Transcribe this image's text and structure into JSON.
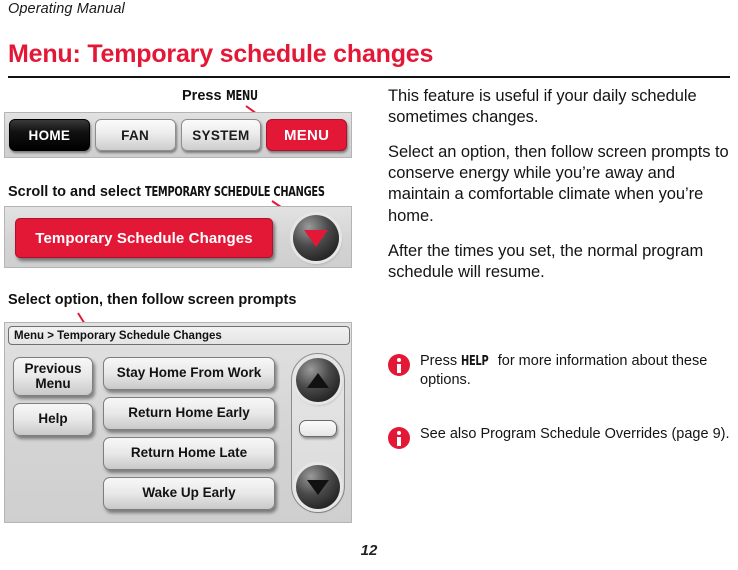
{
  "running_head": "Operating Manual",
  "page_title": "Menu: Temporary schedule changes",
  "folio": "12",
  "accent_color": "#E31837",
  "steps": [
    {
      "callout_prefix": "Press ",
      "callout_key": "MENU",
      "tabs": [
        {
          "label": "HOME",
          "style": "dark"
        },
        {
          "label": "FAN",
          "style": "light"
        },
        {
          "label": "SYSTEM",
          "style": "light"
        },
        {
          "label": "MENU",
          "style": "accent"
        }
      ]
    },
    {
      "callout_prefix": "Scroll to and select ",
      "callout_key": "TEMPORARY SCHEDULE CHANGES",
      "selected_row": "Temporary Schedule Changes",
      "scroll_down_icon": "triangle-down-icon"
    },
    {
      "callout": "Select option, then follow screen prompts",
      "breadcrumb": "Menu > Temporary Schedule Changes",
      "side_buttons": [
        "Previous\nMenu",
        "Help"
      ],
      "side_buttons_display": [
        "Previous Menu",
        "Help"
      ],
      "options": [
        "Stay Home From Work",
        "Return Home Early",
        "Return Home Late",
        "Wake Up Early"
      ],
      "scroll_up_icon": "triangle-up-icon",
      "scroll_down_icon": "triangle-down-icon"
    }
  ],
  "body": {
    "paragraphs": [
      "This feature is useful if your daily schedule sometimes changes.",
      "Select an option, then follow screen prompts to conserve energy while you’re away and maintain a comfortable climate when you’re home.",
      "After the times you set, the normal program schedule will resume."
    ]
  },
  "notes": [
    {
      "icon": "info-icon",
      "prefix": "Press ",
      "key": "HELP",
      "suffix": " for more information about these options."
    },
    {
      "icon": "info-icon",
      "prefix": "",
      "key": "",
      "suffix": "See also Program Schedule Overrides (page 9)."
    }
  ]
}
